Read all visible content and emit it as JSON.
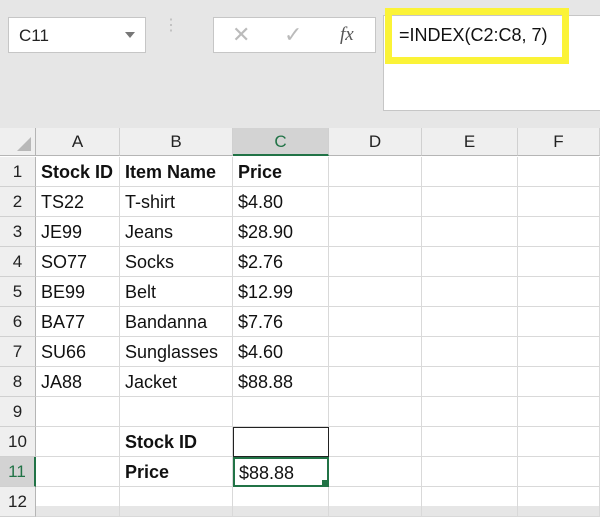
{
  "name_box": "C11",
  "formula_bar": {
    "cancel_icon": "✕",
    "enter_icon": "✓",
    "fx_label": "fx",
    "formula": "=INDEX(C2:C8, 7)"
  },
  "columns": [
    "A",
    "B",
    "C",
    "D",
    "E",
    "F"
  ],
  "rows": [
    "1",
    "2",
    "3",
    "4",
    "5",
    "6",
    "7",
    "8",
    "9",
    "10",
    "11",
    "12"
  ],
  "cells": [
    [
      "Stock ID",
      "Item Name",
      "Price"
    ],
    [
      "TS22",
      "T-shirt",
      "$4.80"
    ],
    [
      "JE99",
      "Jeans",
      "$28.90"
    ],
    [
      "SO77",
      "Socks",
      "$2.76"
    ],
    [
      "BE99",
      "Belt",
      "$12.99"
    ],
    [
      "BA77",
      "Bandanna",
      "$7.76"
    ],
    [
      "SU66",
      "Sunglasses",
      "$4.60"
    ],
    [
      "JA88",
      "Jacket",
      "$88.88"
    ],
    [
      "",
      "",
      ""
    ],
    [
      "",
      "Stock ID",
      ""
    ],
    [
      "",
      "Price",
      "$88.88"
    ],
    [
      "",
      "",
      ""
    ]
  ],
  "selected_cell": "C11",
  "highlight_color": "#fbf337",
  "accent_color": "#217346"
}
